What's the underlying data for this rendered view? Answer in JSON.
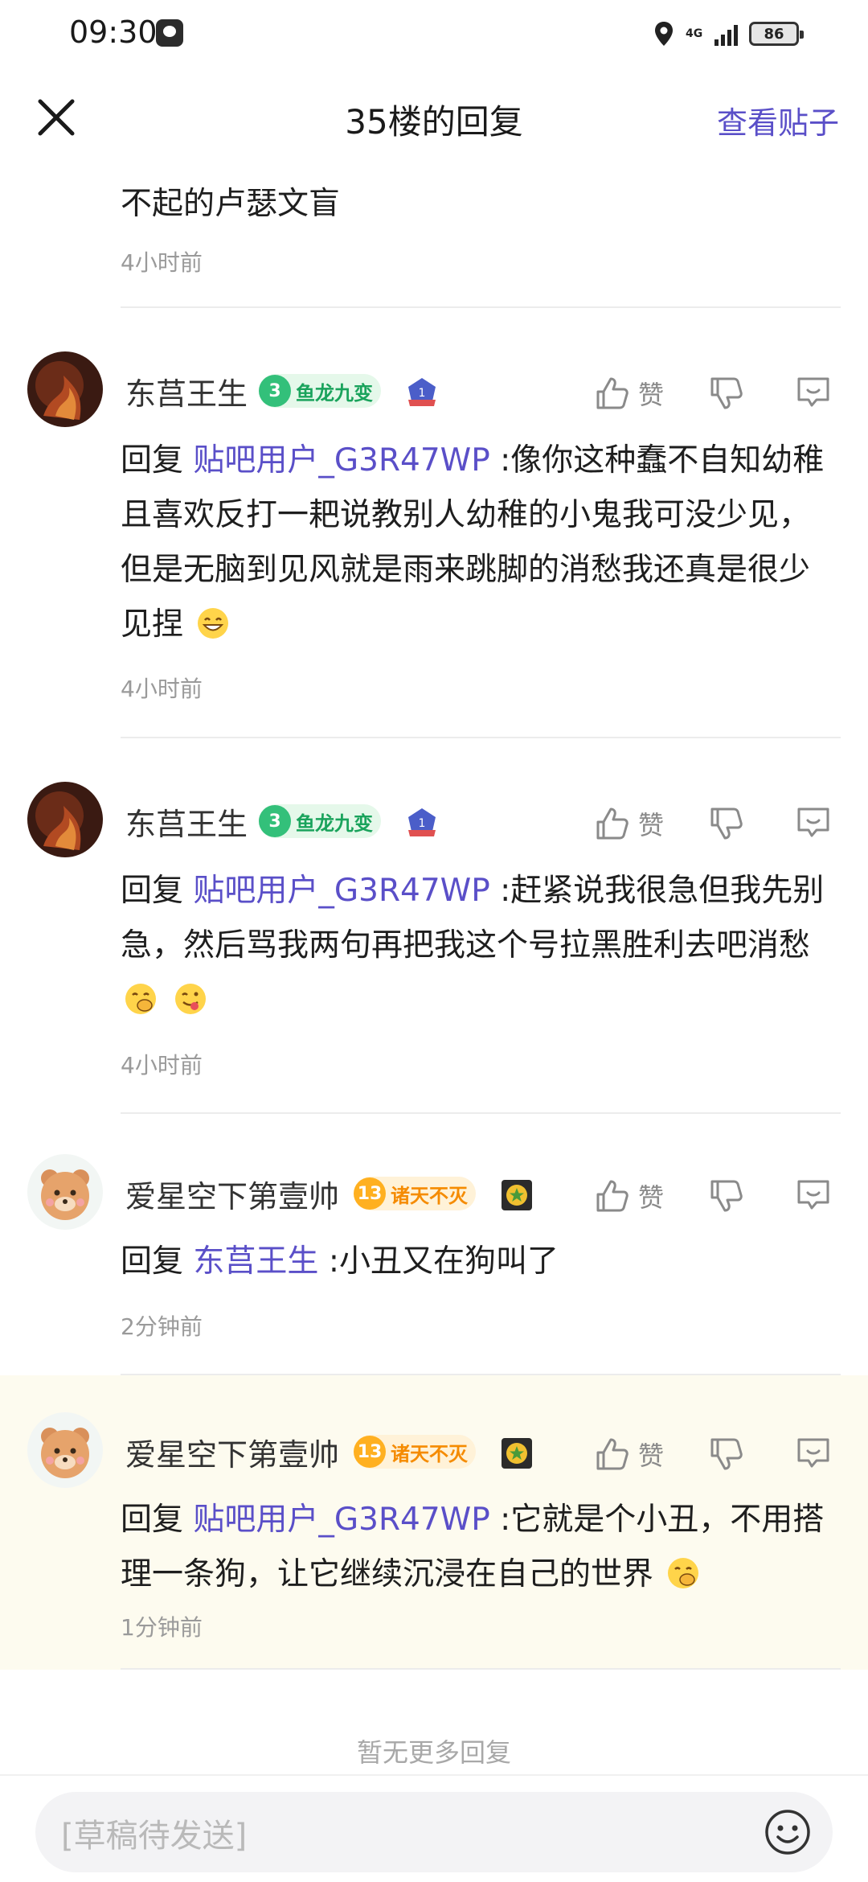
{
  "status_bar": {
    "time": "09:30",
    "network": "4G",
    "battery": "86"
  },
  "header": {
    "title": "35楼的回复",
    "view_post": "查看贴子"
  },
  "top_fragment": {
    "text": "不起的卢瑟文盲",
    "time": "4小时前"
  },
  "like_label": "赞",
  "comments": [
    {
      "user": "东莒王生",
      "badge_level": "3",
      "badge_text": "鱼龙九变",
      "badge_color": "#33c07a",
      "reply_prefix": "回复",
      "mention": "贴吧用户_G3R47WP",
      "text": " :像你这种蠢不自知幼稚且喜欢反打一耙说教别人幼稚的小鬼我可没少见，但是无脑到见风就是雨来跳脚的消愁我还真是很少见捏",
      "time": "4小时前"
    },
    {
      "user": "东莒王生",
      "badge_level": "3",
      "badge_text": "鱼龙九变",
      "badge_color": "#33c07a",
      "reply_prefix": "回复",
      "mention": "贴吧用户_G3R47WP",
      "text": " :赶紧说我很急但我先别急，然后骂我两句再把我这个号拉黑胜利去吧消愁",
      "time": "4小时前"
    },
    {
      "user": "爱星空下第壹帅",
      "badge_level": "13",
      "badge_text": "诸天不灭",
      "badge_color": "#ffb020",
      "reply_prefix": "回复",
      "mention": "东莒王生",
      "text": " :小丑又在狗叫了",
      "time": "2分钟前"
    },
    {
      "user": "爱星空下第壹帅",
      "badge_level": "13",
      "badge_text": "诸天不灭",
      "badge_color": "#ffb020",
      "reply_prefix": "回复",
      "mention": "贴吧用户_G3R47WP",
      "text": " :它就是个小丑，不用搭理一条狗，让它继续沉浸在自己的世界",
      "time": "1分钟前"
    }
  ],
  "footer": {
    "no_more": "暂无更多回复",
    "input_placeholder": "[草稿待发送]"
  },
  "colors": {
    "accent": "#5a4fc8",
    "highlight_bg": "#fdfbef"
  }
}
